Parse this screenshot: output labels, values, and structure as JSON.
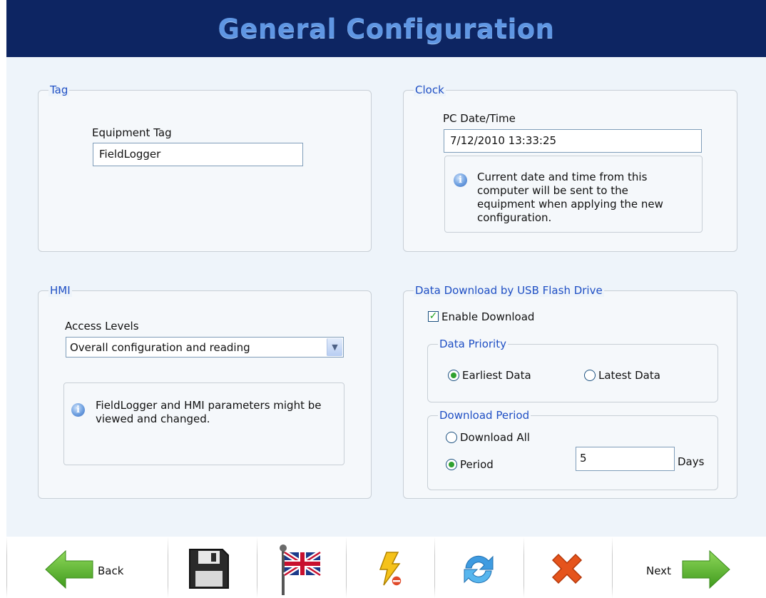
{
  "header": {
    "title": "General Configuration"
  },
  "tag": {
    "legend": "Tag",
    "equipment_tag_label": "Equipment Tag",
    "equipment_tag_value": "FieldLogger"
  },
  "clock": {
    "legend": "Clock",
    "pc_datetime_label": "PC Date/Time",
    "pc_datetime_value": "7/12/2010 13:33:25",
    "info_text": "Current date and time from this computer will be sent to the equipment when applying the new configuration."
  },
  "hmi": {
    "legend": "HMI",
    "access_levels_label": "Access Levels",
    "access_levels_selected": "Overall configuration and reading",
    "info_text": "FieldLogger and HMI parameters might be viewed and changed."
  },
  "usb": {
    "legend": "Data Download by USB Flash Drive",
    "enable_download_label": "Enable Download",
    "enable_download_checked": true,
    "data_priority": {
      "legend": "Data Priority",
      "options": [
        "Earliest Data",
        "Latest Data"
      ],
      "selected": "Earliest Data"
    },
    "download_period": {
      "legend": "Download Period",
      "download_all_label": "Download All",
      "period_label": "Period",
      "selected": "Period",
      "period_value": "5",
      "days_label": "Days"
    }
  },
  "toolbar": {
    "back_label": "Back",
    "next_label": "Next",
    "icons": [
      "back-arrow-icon",
      "save-icon",
      "language-flag-icon",
      "lightning-icon",
      "refresh-icon",
      "close-icon",
      "next-arrow-icon"
    ]
  },
  "colors": {
    "title_bar": "#0d2562",
    "title_text": "#5f96e3",
    "legend_text": "#1f4fc4",
    "content_bg": "#eef4fa",
    "arrow_green": "#55b52a",
    "close_orange": "#e5541c"
  }
}
